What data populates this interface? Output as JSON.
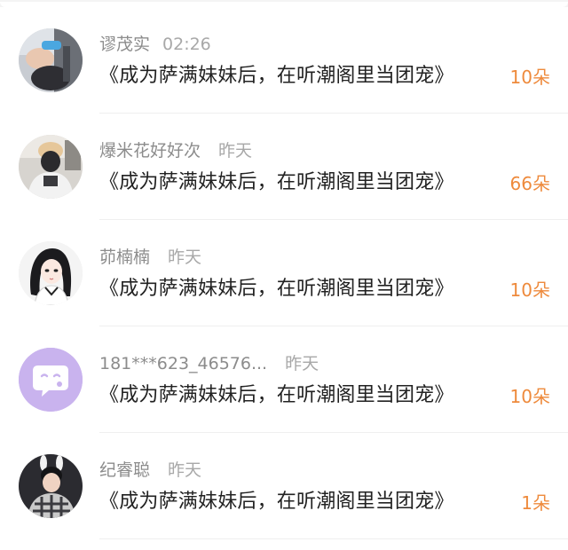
{
  "items": [
    {
      "name": "谬茂实",
      "time": "02:26",
      "message": "《成为萨满妹妹后，在听潮阁里当团宠》",
      "gift": "10朵",
      "avatar_icon": "photo-avatar-icon"
    },
    {
      "name": "爆米花好好次",
      "time": "昨天",
      "message": "《成为萨满妹妹后，在听潮阁里当团宠》",
      "gift": "66朵",
      "avatar_icon": "photo-avatar-icon"
    },
    {
      "name": "茆楠楠",
      "time": "昨天",
      "message": "《成为萨满妹妹后，在听潮阁里当团宠》",
      "gift": "10朵",
      "avatar_icon": "anime-girl-avatar-icon"
    },
    {
      "name": "181***623_46576...",
      "time": "昨天",
      "message": "《成为萨满妹妹后，在听潮阁里当团宠》",
      "gift": "10朵",
      "avatar_icon": "chat-bubble-avatar-icon"
    },
    {
      "name": "纪睿聪",
      "time": "昨天",
      "message": "《成为萨满妹妹后，在听潮阁里当团宠》",
      "gift": "1朵",
      "avatar_icon": "photo-avatar-icon"
    }
  ],
  "colors": {
    "gift": "#ee8a3c",
    "name": "#8c8c8c",
    "message": "#222222",
    "default_avatar": "#c9b3ee"
  }
}
